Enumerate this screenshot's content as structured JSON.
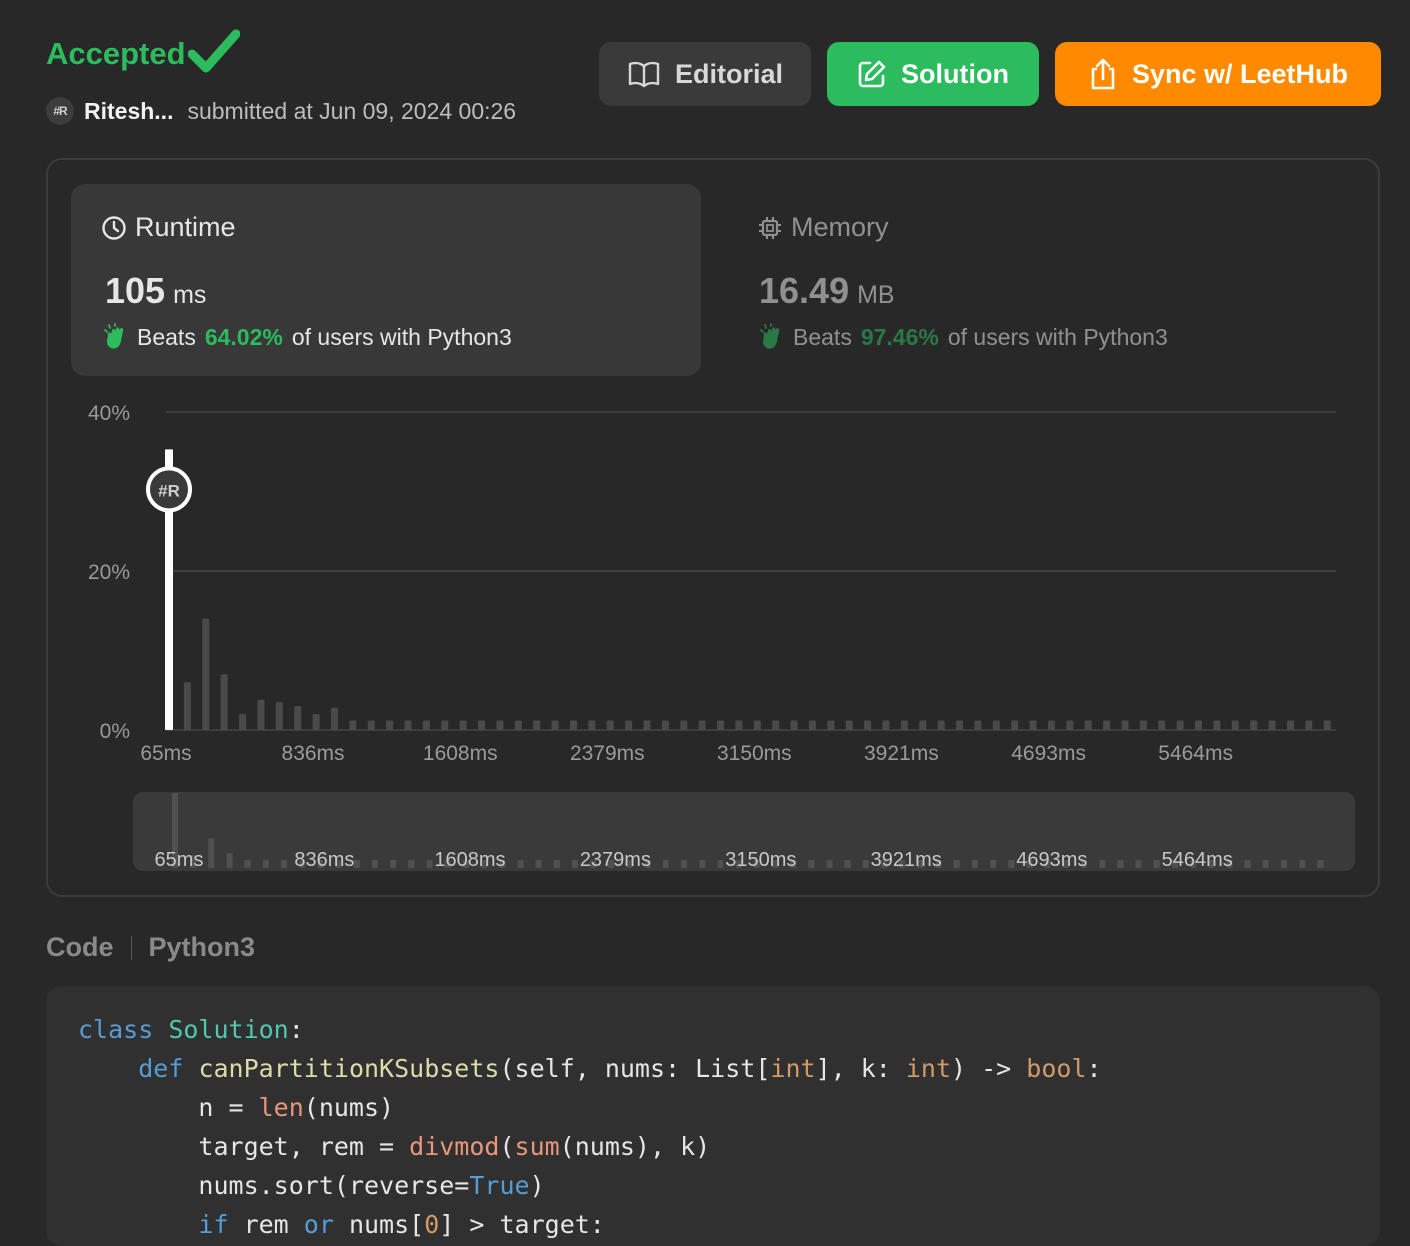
{
  "header": {
    "status": "Accepted",
    "avatar_text": "#R",
    "username": "Ritesh...",
    "submitted_text": "submitted at Jun 09, 2024 00:26"
  },
  "buttons": {
    "editorial": "Editorial",
    "solution": "Solution",
    "sync": "Sync w/ LeetHub"
  },
  "runtime": {
    "title": "Runtime",
    "value": "105",
    "unit": "ms",
    "beats_label": "Beats",
    "percent": "64.02%",
    "suffix": "of users with Python3"
  },
  "memory": {
    "title": "Memory",
    "value": "16.49",
    "unit": "MB",
    "beats_label": "Beats",
    "percent": "97.46%",
    "suffix": "of users with Python3"
  },
  "colors": {
    "accent_green": "#2cbb5d",
    "accent_orange": "#ff8a00",
    "bar": "#4a4a4a",
    "marker": "#ffffff"
  },
  "chart_data": {
    "type": "bar",
    "y_tick_labels": [
      "0%",
      "20%",
      "40%"
    ],
    "ylim": [
      0,
      40
    ],
    "x_tick_labels": [
      "65ms",
      "836ms",
      "1608ms",
      "2379ms",
      "3150ms",
      "3921ms",
      "4693ms",
      "5464ms"
    ],
    "xlim_ms": [
      65,
      6200
    ],
    "bar_step_ms": 96.4,
    "values": [
      35.3,
      6.0,
      14.0,
      7.0,
      2.0,
      3.8,
      3.5,
      3.0,
      2.0,
      2.8,
      1.2,
      1.2,
      1.2,
      1.2,
      1.2,
      1.2,
      1.2,
      1.2,
      1.2,
      1.2,
      1.2,
      1.2,
      1.2,
      1.2,
      1.2,
      1.2,
      1.2,
      1.2,
      1.2,
      1.2,
      1.2,
      1.2,
      1.2,
      1.2,
      1.2,
      1.2,
      1.2,
      1.2,
      1.2,
      1.2,
      1.2,
      1.2,
      1.2,
      1.2,
      1.2,
      1.2,
      1.2,
      1.2,
      1.2,
      1.2,
      1.2,
      1.2,
      1.2,
      1.2,
      1.2,
      1.2,
      1.2,
      1.2,
      1.2,
      1.2,
      1.2,
      1.2,
      1.2,
      1.2
    ],
    "highlight_index": 0,
    "highlight_label": "#R",
    "grid": true
  },
  "code": {
    "label": "Code",
    "language": "Python3"
  }
}
